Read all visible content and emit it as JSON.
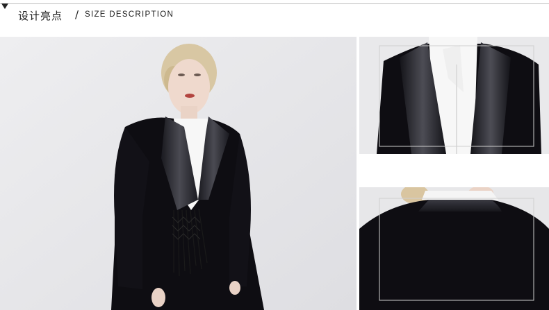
{
  "header": {
    "title_zh": "设计亮点",
    "separator": "/",
    "title_en": "SIZE DESCRIPTION"
  },
  "photos": {
    "main": "model-black-blazer-photo",
    "detail_top": "collar-front-detail-photo",
    "detail_bottom": "collar-back-detail-photo"
  },
  "colors": {
    "jacket": "#0e0d12",
    "lapel_satin": "#2a2a30",
    "shirt": "#f7f7f7",
    "background": "#e7e7e9",
    "rule": "#bdbdbd"
  }
}
